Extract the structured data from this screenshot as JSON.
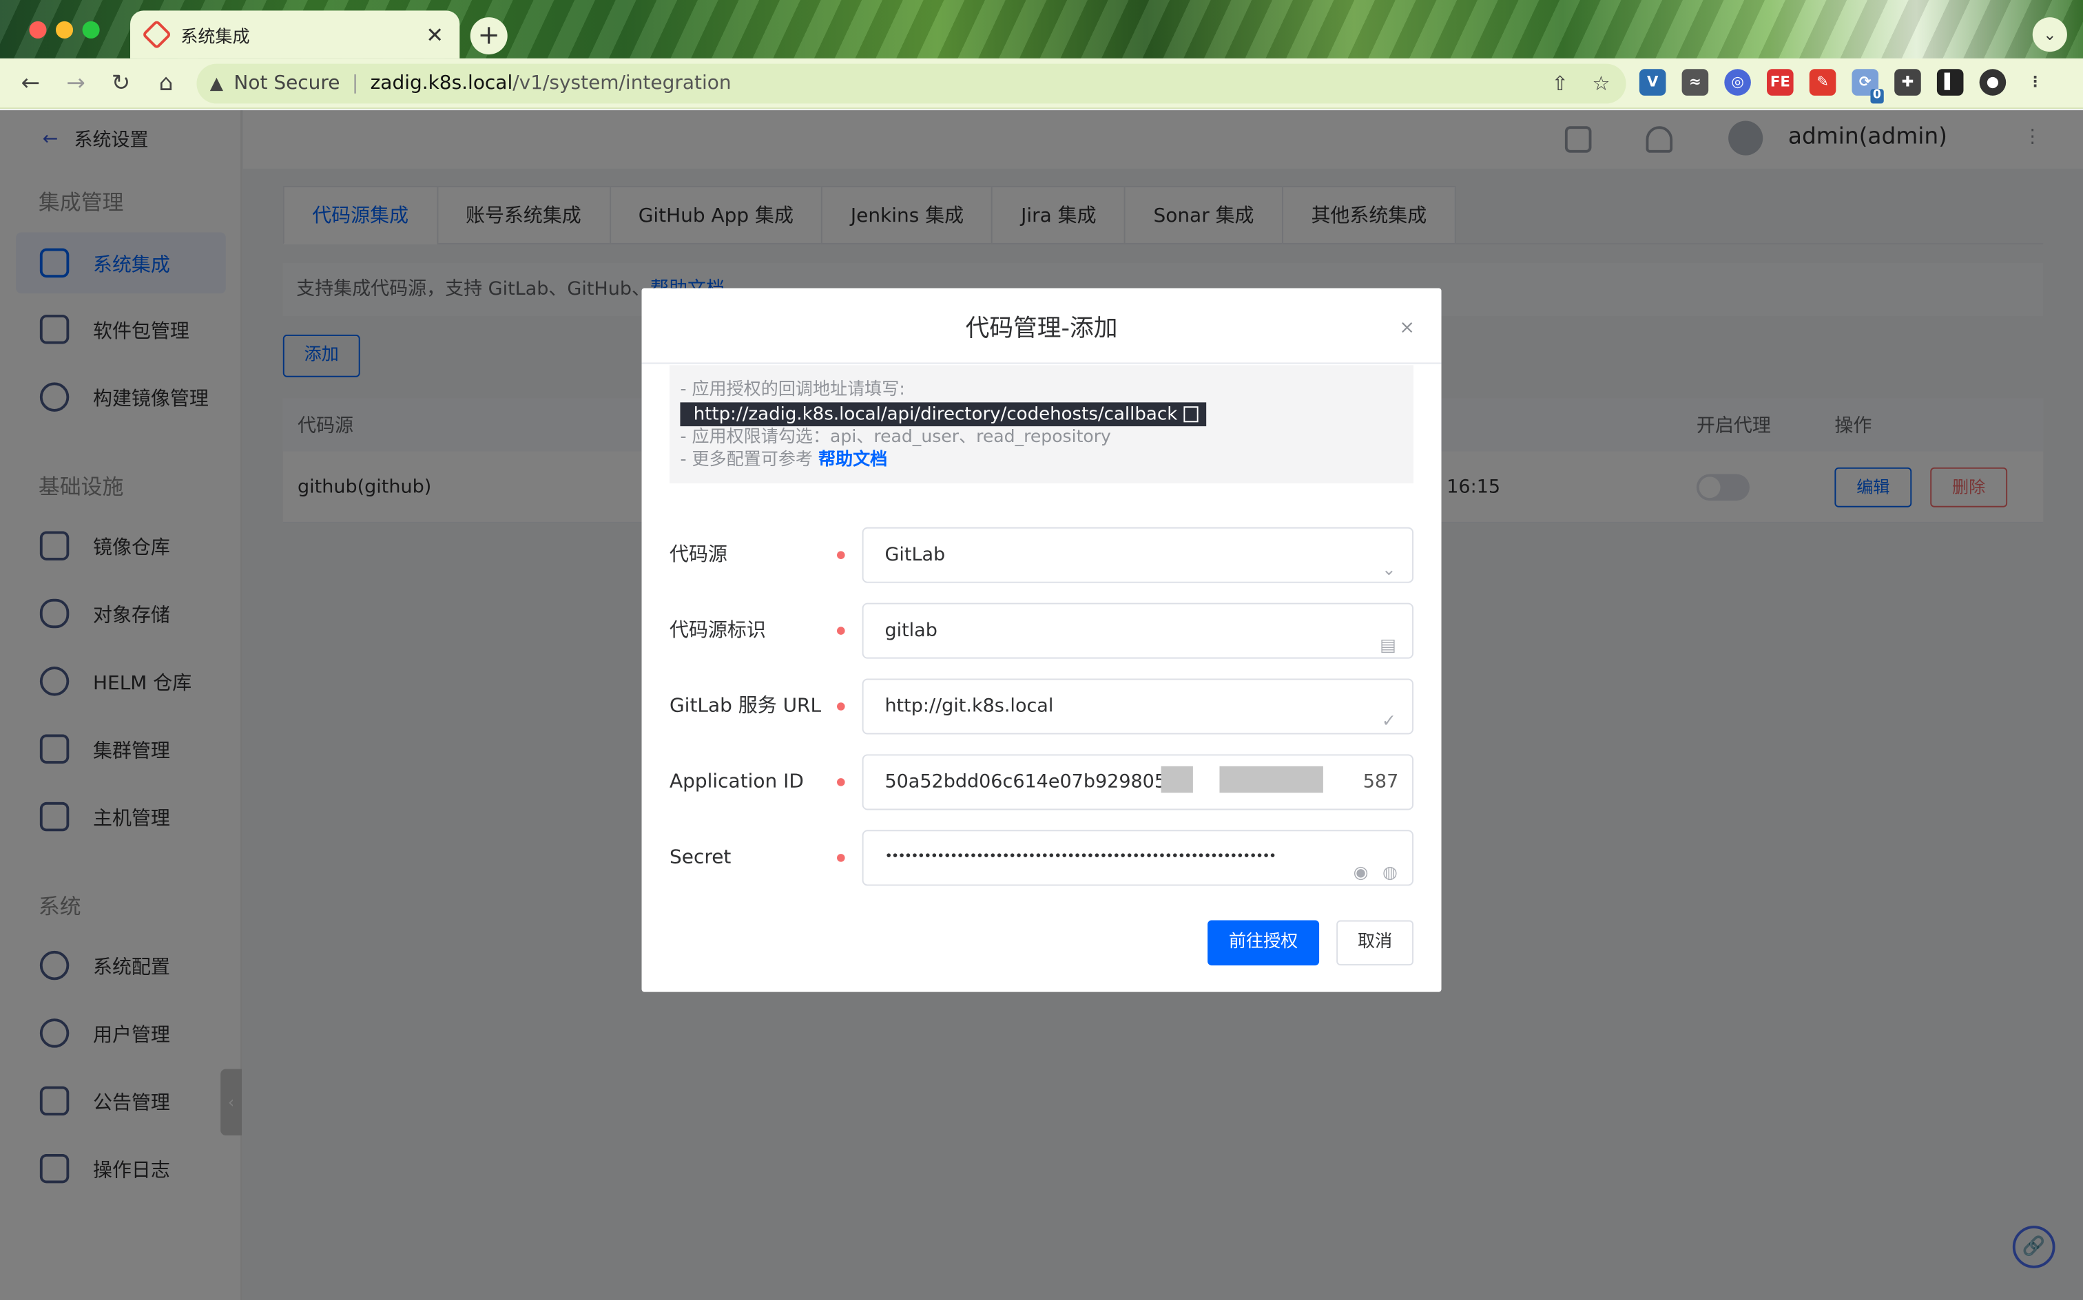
{
  "browser": {
    "tab_title": "系统集成",
    "tab_close": "✕",
    "new_tab": "+",
    "tab_dropdown": "⌄",
    "security_label": "Not Secure",
    "url_host": "zadig.k8s.local",
    "url_path": "/v1/system/integration",
    "ext_badge": "0"
  },
  "sidebar": {
    "back_label": "系统设置",
    "groups": [
      {
        "title": "集成管理",
        "items": [
          "系统集成",
          "软件包管理",
          "构建镜像管理"
        ]
      },
      {
        "title": "基础设施",
        "items": [
          "镜像仓库",
          "对象存储",
          "HELM 仓库",
          "集群管理",
          "主机管理"
        ]
      },
      {
        "title": "系统",
        "items": [
          "系统配置",
          "用户管理",
          "公告管理",
          "操作日志"
        ]
      }
    ],
    "active_item": "系统集成"
  },
  "header": {
    "username": "admin(admin)"
  },
  "tabs": [
    "代码源集成",
    "账号系统集成",
    "GitHub App 集成",
    "Jenkins 集成",
    "Jira 集成",
    "Sonar 集成",
    "其他系统集成"
  ],
  "tip": {
    "text": "支持集成代码源，支持 GitLab、GitHub、",
    "link": "帮助文档"
  },
  "add_button": "添加",
  "table": {
    "headers": [
      "代码源",
      "开启代理",
      "操作"
    ],
    "rows": [
      {
        "source": "github(github)",
        "time": "16:15",
        "edit": "编辑",
        "delete": "删除"
      }
    ]
  },
  "dialog": {
    "title": "代码管理-添加",
    "hint_line1": "- 应用授权的回调地址请填写:",
    "callback_url": "http://zadig.k8s.local/api/directory/codehosts/callback",
    "hint_line2": "- 应用权限请勾选：api、read_user、read_repository",
    "hint_line3": "- 更多配置可参考 ",
    "hint_link": "帮助文档",
    "fields": [
      {
        "label": "代码源",
        "value": "GitLab"
      },
      {
        "label": "代码源标识",
        "value": "gitlab"
      },
      {
        "label": "GitLab 服务 URL",
        "value": "http://git.k8s.local"
      },
      {
        "label": "Application ID",
        "value": "50a52bdd06c614e07b9298053",
        "value_tail": "587"
      },
      {
        "label": "Secret",
        "value": "••••••••••••••••••••••••••••••••••••••••••••••••••••••••••••"
      }
    ],
    "confirm": "前往授权",
    "cancel": "取消"
  },
  "colors": {
    "primary": "#0066ff",
    "danger": "#f56c6c",
    "required": "#f56c6c"
  }
}
